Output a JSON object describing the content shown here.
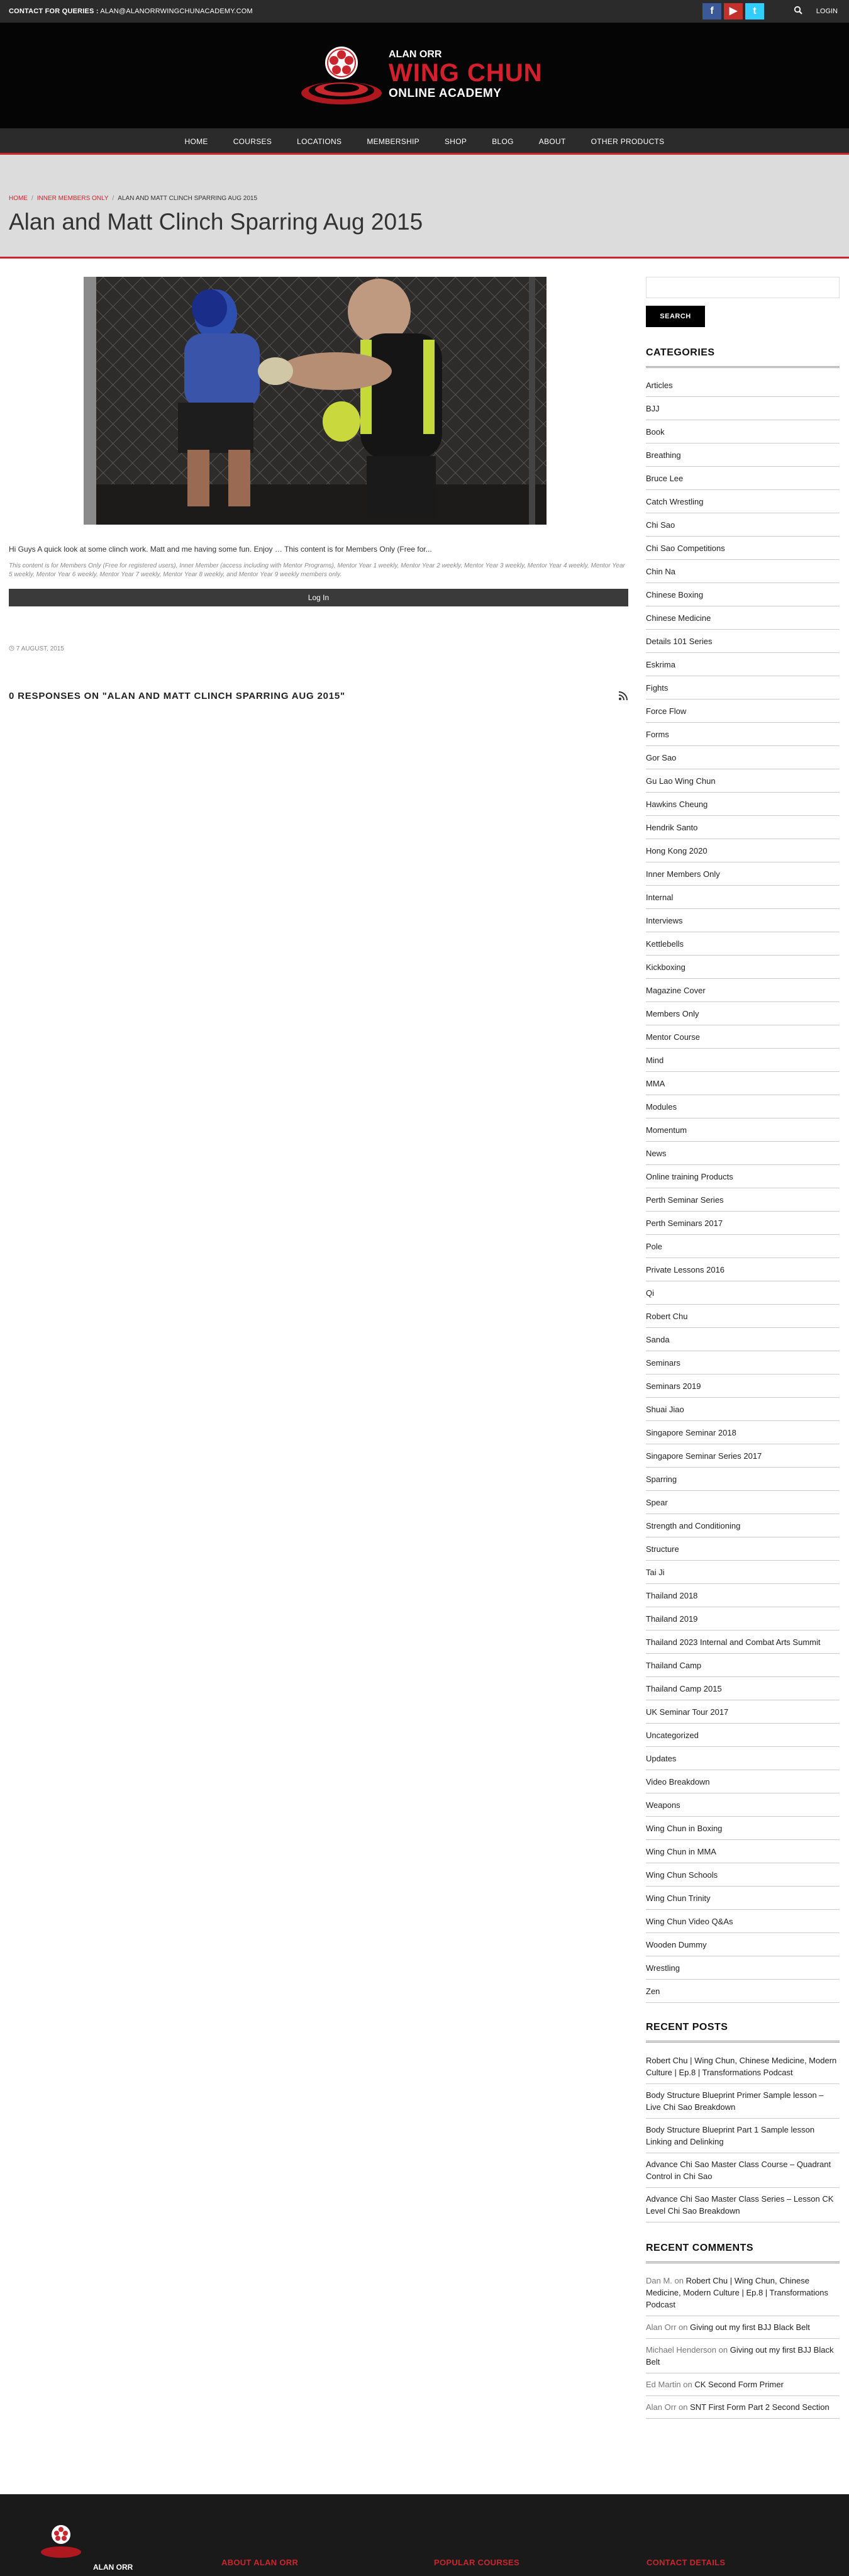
{
  "topbar": {
    "contact_label": "CONTACT FOR QUERIES :",
    "contact_email": "ALAN@ALANORRWINGCHUNACADEMY.COM",
    "login": "LOGIN",
    "social": [
      "f",
      "▶",
      "t"
    ]
  },
  "logo": {
    "line1": "ALAN ORR",
    "line2": "WING CHUN",
    "line3": "ONLINE ACADEMY"
  },
  "nav": [
    "HOME",
    "COURSES",
    "LOCATIONS",
    "MEMBERSHIP",
    "SHOP",
    "BLOG",
    "ABOUT",
    "OTHER PRODUCTS"
  ],
  "breadcrumb": {
    "home": "HOME",
    "section": "INNER MEMBERS ONLY",
    "current": "ALAN AND MATT CLINCH SPARRING AUG 2015"
  },
  "page_title": "Alan and Matt Clinch Sparring Aug 2015",
  "post": {
    "excerpt": "Hi Guys A quick look at some clinch work. Matt and me having some fun. Enjoy … This content is for Members Only (Free for...",
    "members_note": "This content is for Members Only (Free for registered users), Inner Member (access including with Mentor Programs), Mentor Year 1 weekly, Mentor Year 2 weekly, Mentor Year 3 weekly, Mentor Year 4 weekly, Mentor Year 5 weekly, Mentor Year 6 weekly, Mentor Year 7 weekly, Mentor Year 8 weekly, and Mentor Year 9 weekly members only.",
    "login_button": "Log In",
    "date": "7 AUGUST, 2015",
    "responses_heading": "0 RESPONSES ON \"ALAN AND MATT CLINCH SPARRING AUG 2015\""
  },
  "sidebar": {
    "search_placeholder": "",
    "search_button": "SEARCH",
    "categories_title": "CATEGORIES",
    "categories": [
      "Articles",
      "BJJ",
      "Book",
      "Breathing",
      "Bruce Lee",
      "Catch Wrestling",
      "Chi Sao",
      "Chi Sao Competitions",
      "Chin Na",
      "Chinese Boxing",
      "Chinese Medicine",
      "Details 101 Series",
      "Eskrima",
      "Fights",
      "Force Flow",
      "Forms",
      "Gor Sao",
      "Gu Lao Wing Chun",
      "Hawkins Cheung",
      "Hendrik Santo",
      "Hong Kong 2020",
      "Inner Members Only",
      "Internal",
      "Interviews",
      "Kettlebells",
      "Kickboxing",
      "Magazine Cover",
      "Members Only",
      "Mentor Course",
      "Mind",
      "MMA",
      "Modules",
      "Momentum",
      "News",
      "Online training Products",
      "Perth Seminar Series",
      "Perth Seminars 2017",
      "Pole",
      "Private Lessons 2016",
      "Qi",
      "Robert Chu",
      "Sanda",
      "Seminars",
      "Seminars 2019",
      "Shuai Jiao",
      "Singapore Seminar 2018",
      "Singapore Seminar Series 2017",
      "Sparring",
      "Spear",
      "Strength and Conditioning",
      "Structure",
      "Tai Ji",
      "Thailand 2018",
      "Thailand 2019",
      "Thailand 2023 Internal and Combat Arts Summit",
      "Thailand Camp",
      "Thailand Camp 2015",
      "UK Seminar Tour 2017",
      "Uncategorized",
      "Updates",
      "Video Breakdown",
      "Weapons",
      "Wing Chun in Boxing",
      "Wing Chun in MMA",
      "Wing Chun Schools",
      "Wing Chun Trinity",
      "Wing Chun Video Q&As",
      "Wooden Dummy",
      "Wrestling",
      "Zen"
    ],
    "recent_posts_title": "RECENT POSTS",
    "recent_posts": [
      "Robert Chu | Wing Chun, Chinese Medicine, Modern Culture | Ep.8 | Transformations Podcast",
      "Body Structure Blueprint Primer Sample lesson – Live Chi Sao Breakdown",
      "Body Structure Blueprint Part 1 Sample lesson Linking and Delinking",
      "Advance Chi Sao Master Class Course – Quadrant Control in Chi Sao",
      "Advance Chi Sao Master Class Series – Lesson CK Level Chi Sao Breakdown"
    ],
    "recent_comments_title": "RECENT COMMENTS",
    "recent_comments": [
      {
        "author": "Dan M.",
        "on": "on",
        "post": "Robert Chu | Wing Chun, Chinese Medicine, Modern Culture | Ep.8 | Transformations Podcast"
      },
      {
        "author": "Alan Orr",
        "on": "on",
        "post": "Giving out my first BJJ Black Belt"
      },
      {
        "author": "Michael Henderson",
        "on": "on",
        "post": "Giving out my first BJJ Black Belt"
      },
      {
        "author": "Ed Martin",
        "on": "on",
        "post": "CK Second Form Primer"
      },
      {
        "author": "Alan Orr",
        "on": "on",
        "post": "SNT First Form Part 2 Second Section"
      }
    ]
  },
  "footer": {
    "logo_text": "ALAN ORR",
    "headings": [
      "ABOUT ALAN ORR",
      "POPULAR COURSES",
      "CONTACT DETAILS"
    ]
  },
  "colors": {
    "accent": "#c9262e",
    "topbar": "#2b2b2b",
    "header": "#050505",
    "pagehead": "#dcdcdc"
  }
}
